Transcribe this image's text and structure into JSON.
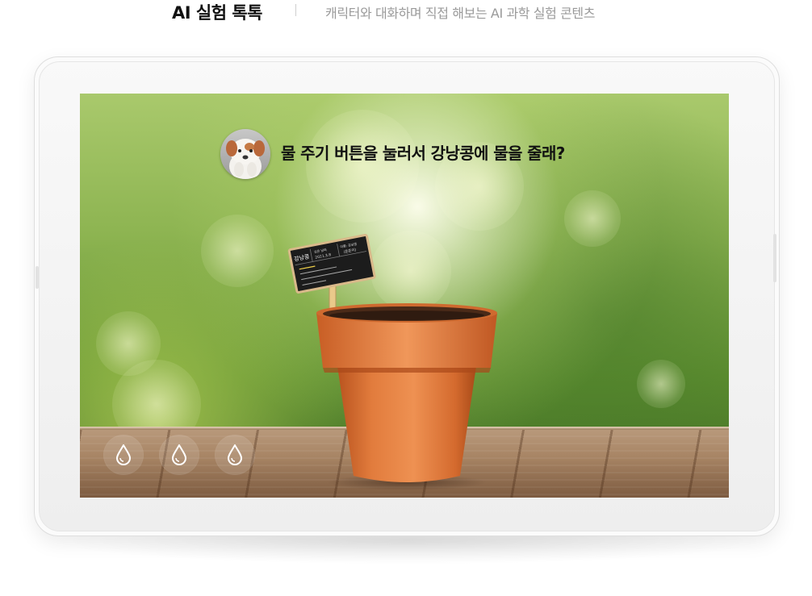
{
  "header": {
    "title": "AI 실험 톡톡",
    "subtitle": "캐릭터와 대화하며 직접 해보는 AI 과학 실험 콘텐츠"
  },
  "screen": {
    "speech_text": "물 주기 버튼을 눌러서 강낭콩에 물을 줄래?",
    "character_icon": "dog-character-avatar",
    "sign": {
      "plant_name": "강낭콩",
      "date_label": "심은 날짜",
      "date": "2021.3.8",
      "extra_label": "이름: 강낭콩",
      "extra_value": "(튼튼이)"
    },
    "water_buttons": [
      {
        "icon": "water-drop-icon"
      },
      {
        "icon": "water-drop-icon"
      },
      {
        "icon": "water-drop-icon"
      }
    ]
  },
  "colors": {
    "pot": "#e07a3c",
    "pot_rim": "#e9894a",
    "background_green": "#8db451",
    "deck_wood": "#a88565"
  }
}
